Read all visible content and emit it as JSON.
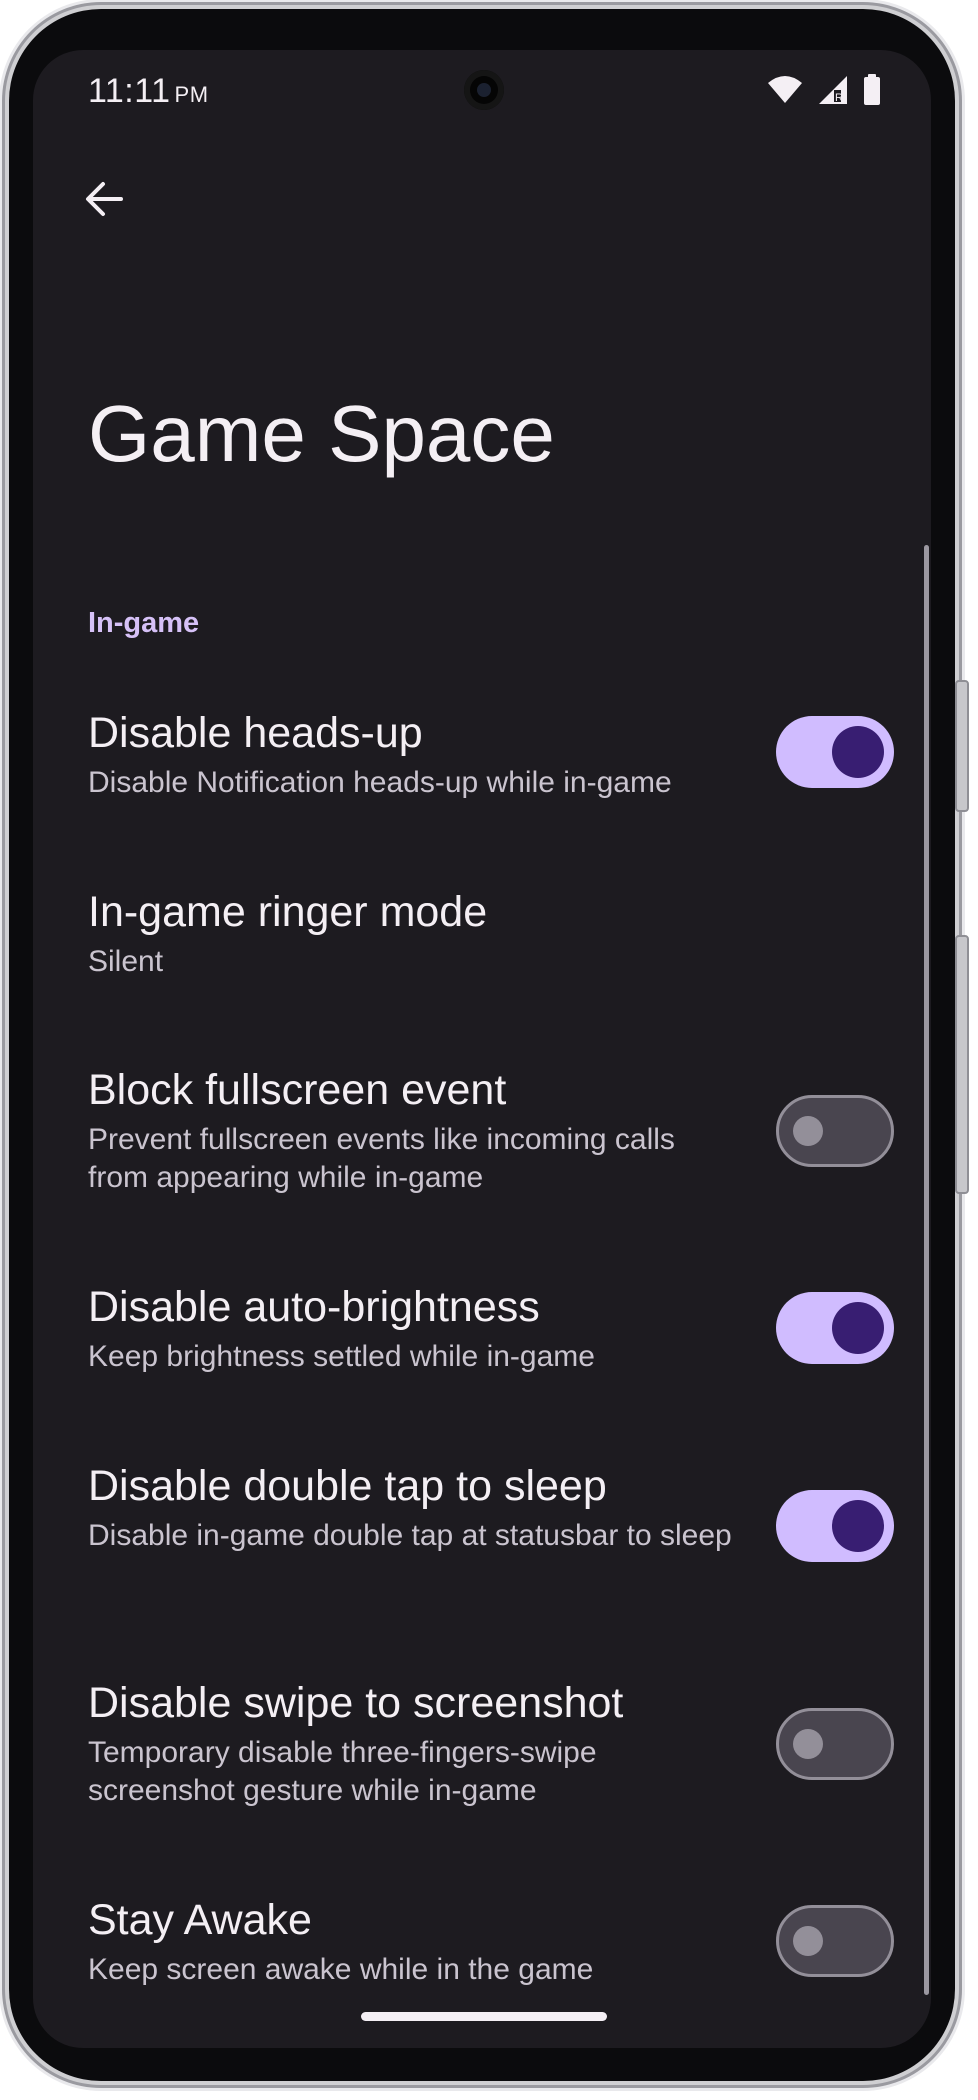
{
  "status_bar": {
    "time": "11:11",
    "ampm": "PM",
    "icons": [
      "wifi-icon",
      "cell-signal-icon",
      "battery-icon"
    ]
  },
  "header": {
    "back_icon": "arrow-back-icon",
    "title": "Game Space"
  },
  "section": {
    "title": "In-game"
  },
  "preferences": [
    {
      "title": "Disable heads-up",
      "summary": "Disable Notification heads-up while in-game",
      "switch": true
    },
    {
      "title": "In-game ringer mode",
      "summary": "Silent"
    },
    {
      "title": "Block fullscreen event",
      "summary": "Prevent fullscreen events like incoming calls from appearing while in-game",
      "switch": false
    },
    {
      "title": "Disable auto-brightness",
      "summary": "Keep brightness settled while in-game",
      "switch": true
    },
    {
      "title": "Disable double tap to sleep",
      "summary": "Disable in-game double tap at statusbar to sleep",
      "switch": true
    },
    {
      "title": "Disable swipe to screenshot",
      "summary": "Temporary disable three-fingers-swipe screenshot gesture while in-game",
      "switch": false
    },
    {
      "title": "Stay Awake",
      "summary": "Keep screen awake while in the game",
      "switch": false
    }
  ],
  "colors": {
    "background": "#1d1b20",
    "accent": "#d0bcff",
    "switch_on_thumb": "#381e72",
    "text_primary": "#f4eff4",
    "text_secondary": "#cac4cf"
  }
}
